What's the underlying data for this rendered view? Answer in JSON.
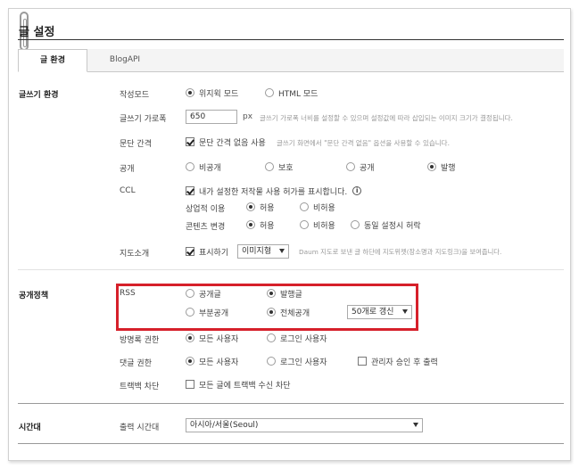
{
  "title": "글 설정",
  "tabs": [
    {
      "label": "글 환경",
      "active": true
    },
    {
      "label": "BlogAPI",
      "active": false
    }
  ],
  "writing": {
    "section_label": "글쓰기 환경",
    "mode": {
      "label": "작성모드",
      "options": [
        "위지윅 모드",
        "HTML 모드"
      ],
      "selected": "위지윅 모드"
    },
    "width": {
      "label": "글쓰기 가로폭",
      "value": "650",
      "unit": "px",
      "hint": "글쓰기 가로폭 너비를 설정할 수 있으며 설정값에 따라 삽입되는 이미지 크기가 결정됩니다."
    },
    "paragraph": {
      "label": "문단 간격",
      "check_label": "문단 간격 없음 사용",
      "checked": true,
      "hint": "글쓰기 화면에서 \"문단 간격 없음\" 옵션을 사용할 수 있습니다."
    },
    "visibility": {
      "label": "공개",
      "options": [
        "비공개",
        "보호",
        "공개",
        "발행"
      ],
      "selected": "발행"
    },
    "ccl": {
      "label": "CCL",
      "check_label": "내가 설정한 저작물 사용 허가를 표시합니다.",
      "checked": true,
      "info_icon": "i",
      "commercial": {
        "label": "상업적 이용",
        "options": [
          "허용",
          "비허용"
        ],
        "selected": "허용"
      },
      "modify": {
        "label": "콘텐츠 변경",
        "options": [
          "허용",
          "비허용",
          "동일 설정시 허락"
        ],
        "selected": "허용"
      }
    },
    "map": {
      "label": "지도소개",
      "check_label": "표시하기",
      "checked": true,
      "select_value": "이미지형",
      "hint": "Daum 지도로 보낸 글 하단에 지도위젯(장소명과 지도링크)을 보여줍니다."
    }
  },
  "policy": {
    "section_label": "공개정책",
    "rss": {
      "label": "RSS",
      "scope_options": [
        "공개글",
        "발행글"
      ],
      "scope_selected": "발행글",
      "content_options": [
        "부분공개",
        "전체공개"
      ],
      "content_selected": "전체공개",
      "count_value": "50개로 갱신"
    },
    "guestbook": {
      "label": "방명록 권한",
      "options": [
        "모든 사용자",
        "로그인 사용자"
      ],
      "selected": "모든 사용자"
    },
    "comment": {
      "label": "댓글 권한",
      "options": [
        "모든 사용자",
        "로그인 사용자"
      ],
      "selected": "모든 사용자",
      "approve_label": "관리자 승인 후 출력",
      "approve_checked": false
    },
    "trackback": {
      "label": "트랙백 차단",
      "check_label": "모든 글에 트랙백 수신 차단",
      "checked": false
    }
  },
  "timezone": {
    "section_label": "시간대",
    "label": "출력 시간대",
    "value": "아시아/서울(Seoul)"
  },
  "colors": {
    "highlight": "#d6202a"
  }
}
